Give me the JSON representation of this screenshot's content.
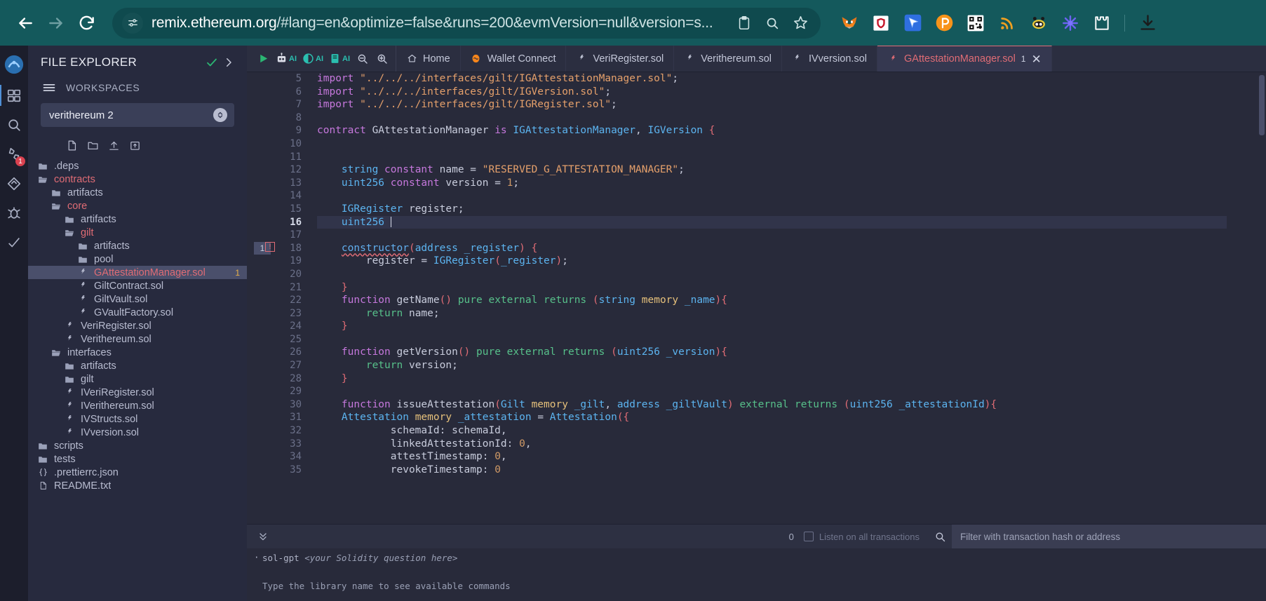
{
  "browser": {
    "back_icon": "arrow-left-icon",
    "forward_icon": "arrow-right-icon",
    "reload_icon": "reload-icon",
    "site_info_icon": "site-settings-icon",
    "url_host": "remix.ethereum.org",
    "url_path": "/#lang=en&optimize=false&runs=200&evmVersion=null&version=s...",
    "omni_icons": [
      "clipboard-icon",
      "search-icon",
      "star-icon"
    ],
    "extensions": [
      {
        "name": "metamask-extension-icon"
      },
      {
        "name": "shield-extension-icon"
      },
      {
        "name": "cursor-extension-icon"
      },
      {
        "name": "phantom-extension-icon"
      },
      {
        "name": "qr-code-extension-icon"
      },
      {
        "name": "rss-feed-extension-icon"
      },
      {
        "name": "bee-extension-icon"
      },
      {
        "name": "asterisk-extension-icon"
      },
      {
        "name": "puzzle-extensions-icon"
      }
    ],
    "download_icon": "download-icon"
  },
  "icon_rail": [
    {
      "name": "remix-logo-icon",
      "active": false,
      "badge": ""
    },
    {
      "name": "file-explorer-icon",
      "active": true,
      "badge": ""
    },
    {
      "name": "search-icon",
      "active": false,
      "badge": ""
    },
    {
      "name": "compiler-icon",
      "active": false,
      "badge": "1"
    },
    {
      "name": "deploy-run-icon",
      "active": false,
      "badge": ""
    },
    {
      "name": "debugger-icon",
      "active": false,
      "badge": ""
    },
    {
      "name": "plugin-manager-icon",
      "active": false,
      "badge": ""
    }
  ],
  "file_explorer": {
    "title": "FILE EXPLORER",
    "check_icon": "check-icon",
    "expand_icon": "chevron-right-icon",
    "hamburger_icon": "hamburger-icon",
    "workspaces_label": "WORKSPACES",
    "workspace_value": "verithereum 2",
    "actions": [
      "new-file-icon",
      "new-folder-icon",
      "upload-file-icon",
      "upload-folder-icon"
    ],
    "tree": [
      {
        "label": ".deps",
        "depth": 0,
        "kind": "folder",
        "red": false,
        "selected": false
      },
      {
        "label": "contracts",
        "depth": 0,
        "kind": "folder-open",
        "red": true,
        "selected": false
      },
      {
        "label": "artifacts",
        "depth": 1,
        "kind": "folder",
        "red": false,
        "selected": false
      },
      {
        "label": "core",
        "depth": 1,
        "kind": "folder-open",
        "red": true,
        "selected": false
      },
      {
        "label": "artifacts",
        "depth": 2,
        "kind": "folder",
        "red": false,
        "selected": false
      },
      {
        "label": "gilt",
        "depth": 2,
        "kind": "folder-open",
        "red": true,
        "selected": false
      },
      {
        "label": "artifacts",
        "depth": 3,
        "kind": "folder",
        "red": false,
        "selected": false
      },
      {
        "label": "pool",
        "depth": 3,
        "kind": "folder",
        "red": false,
        "selected": false
      },
      {
        "label": "GAttestationManager.sol",
        "depth": 3,
        "kind": "solidity",
        "red": true,
        "selected": true,
        "badge": "1"
      },
      {
        "label": "GiltContract.sol",
        "depth": 3,
        "kind": "solidity",
        "red": false,
        "selected": false
      },
      {
        "label": "GiltVault.sol",
        "depth": 3,
        "kind": "solidity",
        "red": false,
        "selected": false
      },
      {
        "label": "GVaultFactory.sol",
        "depth": 3,
        "kind": "solidity",
        "red": false,
        "selected": false
      },
      {
        "label": "VeriRegister.sol",
        "depth": 2,
        "kind": "solidity",
        "red": false,
        "selected": false
      },
      {
        "label": "Verithereum.sol",
        "depth": 2,
        "kind": "solidity",
        "red": false,
        "selected": false
      },
      {
        "label": "interfaces",
        "depth": 1,
        "kind": "folder-open",
        "red": false,
        "selected": false
      },
      {
        "label": "artifacts",
        "depth": 2,
        "kind": "folder",
        "red": false,
        "selected": false
      },
      {
        "label": "gilt",
        "depth": 2,
        "kind": "folder",
        "red": false,
        "selected": false
      },
      {
        "label": "IVeriRegister.sol",
        "depth": 2,
        "kind": "solidity",
        "red": false,
        "selected": false
      },
      {
        "label": "IVerithereum.sol",
        "depth": 2,
        "kind": "solidity",
        "red": false,
        "selected": false
      },
      {
        "label": "IVStructs.sol",
        "depth": 2,
        "kind": "solidity",
        "red": false,
        "selected": false
      },
      {
        "label": "IVversion.sol",
        "depth": 2,
        "kind": "solidity",
        "red": false,
        "selected": false
      },
      {
        "label": "scripts",
        "depth": 0,
        "kind": "folder",
        "red": false,
        "selected": false
      },
      {
        "label": "tests",
        "depth": 0,
        "kind": "folder",
        "red": false,
        "selected": false
      },
      {
        "label": ".prettierrc.json",
        "depth": 0,
        "kind": "json",
        "red": false,
        "selected": false
      },
      {
        "label": "README.txt",
        "depth": 0,
        "kind": "text",
        "red": false,
        "selected": false
      }
    ]
  },
  "toolbar": {
    "run_icon": "play-icon",
    "ai_buttons": [
      {
        "icon": "robot-icon",
        "label": "AI"
      },
      {
        "icon": "contrast-icon",
        "label": "AI"
      },
      {
        "icon": "book-icon",
        "label": "AI"
      }
    ],
    "zoom_out_icon": "zoom-out-icon",
    "zoom_in_icon": "zoom-in-icon"
  },
  "tabs": [
    {
      "label": "Home",
      "icon": "home-icon",
      "active": false,
      "badge": "",
      "closable": false
    },
    {
      "label": "Wallet Connect",
      "icon": "wallet-icon",
      "active": false,
      "badge": "",
      "closable": false
    },
    {
      "label": "VeriRegister.sol",
      "icon": "solidity-icon",
      "active": false,
      "badge": "",
      "closable": false
    },
    {
      "label": "Verithereum.sol",
      "icon": "solidity-icon",
      "active": false,
      "badge": "",
      "closable": false
    },
    {
      "label": "IVversion.sol",
      "icon": "solidity-icon",
      "active": false,
      "badge": "",
      "closable": false
    },
    {
      "label": "GAttestationManager.sol",
      "icon": "solidity-icon",
      "active": true,
      "badge": "1",
      "closable": true
    }
  ],
  "editor": {
    "first_line": 5,
    "cursor_line": 16,
    "error_line": 18,
    "error_count": "1",
    "line_numbers": [
      5,
      6,
      7,
      8,
      9,
      10,
      11,
      12,
      13,
      14,
      15,
      16,
      17,
      18,
      19,
      20,
      21,
      22,
      23,
      24,
      25,
      26,
      27,
      28,
      29,
      30,
      31,
      32,
      33,
      34,
      35
    ],
    "code_lines": [
      "import \"../../../interfaces/gilt/IGAttestationManager.sol\";",
      "import \"../../../interfaces/gilt/IGVersion.sol\";",
      "import \"../../../interfaces/gilt/IGRegister.sol\";",
      "",
      "contract GAttestationManager is IGAttestationManager, IGVersion {",
      "",
      "",
      "    string constant name = \"RESERVED_G_ATTESTATION_MANAGER\";",
      "    uint256 constant version = 1;",
      "",
      "    IGRegister register;",
      "    uint256 ",
      "",
      "    constructor(address _register) {",
      "        register = IGRegister(_register);",
      "",
      "    }",
      "    function getName() pure external returns (string memory _name){",
      "        return name;",
      "    }",
      "",
      "    function getVersion() pure external returns (uint256 _version){",
      "        return version;",
      "    }",
      "",
      "    function issueAttestation(Gilt memory _gilt, address _giltVault) external returns (uint256 _attestationId){",
      "    Attestation memory _attestation = Attestation({",
      "            schemaId: schemaId,",
      "            linkedAttestationId: 0,",
      "            attestTimestamp: 0,",
      "            revokeTimestamp: 0"
    ]
  },
  "terminal": {
    "toggle_icon": "chevron-double-down-icon",
    "transaction_count": "0",
    "listen_label": "Listen on all transactions",
    "search_icon": "search-icon",
    "filter_placeholder": "Filter with transaction hash or address",
    "lines": [
      {
        "prefix": "sol-gpt ",
        "italic": "<your Solidity question here>",
        "bullet": true
      },
      {
        "prefix": "",
        "italic": "",
        "bullet": false
      },
      {
        "prefix": "Type the library name to see available commands",
        "italic": "",
        "bullet": false
      }
    ]
  }
}
